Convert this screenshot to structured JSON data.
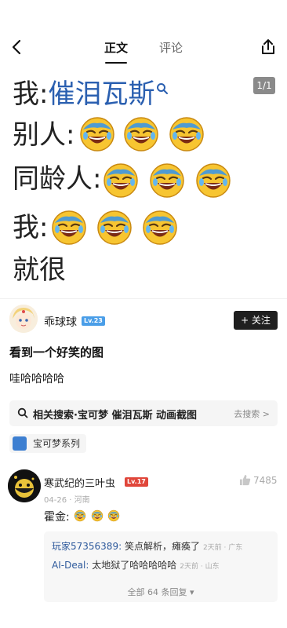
{
  "nav": {
    "tabs": [
      {
        "label": "正文",
        "active": true
      },
      {
        "label": "评论",
        "active": false
      }
    ]
  },
  "meme": {
    "page_indicator": "1/1",
    "line1_prefix": "我:",
    "line1_link": "催泪瓦斯",
    "line2": "别人:",
    "line3": "同龄人:",
    "line4": "我:",
    "line5": "就很"
  },
  "author": {
    "name": "乖球球",
    "level": "Lv.23",
    "follow_label": "+ 关注"
  },
  "post": {
    "title": "看到一个好笑的图",
    "body": "哇哈哈哈哈"
  },
  "related_search": {
    "label": "相关搜索·宝可梦 催泪瓦斯 动画截图",
    "action": "去搜索 >"
  },
  "tag": {
    "label": "宝可梦系列"
  },
  "comment": {
    "user": "寒武纪的三叶虫",
    "level": "Lv.17",
    "meta": "04-26 · 河南",
    "likes": "7485",
    "text": "霍金:"
  },
  "replies": [
    {
      "user": "玩家57356389:",
      "text": " 笑点解析，瘫痪了",
      "meta": "2天前 · 广东"
    },
    {
      "user": "AI-Deal:",
      "text": " 太地狱了哈哈哈哈哈",
      "meta": "2天前 · 山东"
    }
  ],
  "more_replies": "全部 64 条回复 ▾",
  "colors": {
    "link_blue": "#2a5fb0",
    "follow_bg": "#1f1f1f",
    "lv_blue": "#4a9ee8",
    "lv_red": "#e0463a",
    "emoji_yellow": "#f7c531",
    "emoji_blue": "#4f9bd2"
  }
}
